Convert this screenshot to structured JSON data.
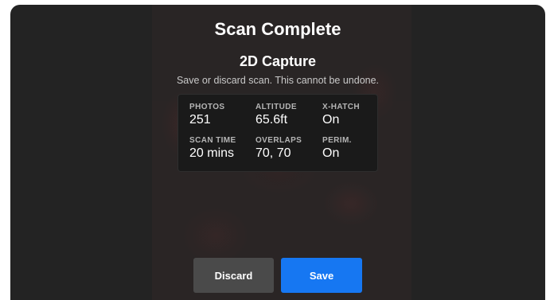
{
  "dialog": {
    "title": "Scan Complete",
    "subtitle": "2D Capture",
    "description": "Save or discard scan. This cannot be undone."
  },
  "stats": [
    {
      "label": "PHOTOS",
      "value": "251"
    },
    {
      "label": "ALTITUDE",
      "value": "65.6ft"
    },
    {
      "label": "X-HATCH",
      "value": "On"
    },
    {
      "label": "SCAN TIME",
      "value": "20 mins"
    },
    {
      "label": "OVERLAPS",
      "value": "70, 70"
    },
    {
      "label": "PERIM.",
      "value": "On"
    }
  ],
  "buttons": {
    "discard_label": "Discard",
    "save_label": "Save"
  },
  "colors": {
    "background": "#232323",
    "card": "#1a1a1a",
    "discard": "#4a4a4a",
    "save": "#1677f2"
  }
}
